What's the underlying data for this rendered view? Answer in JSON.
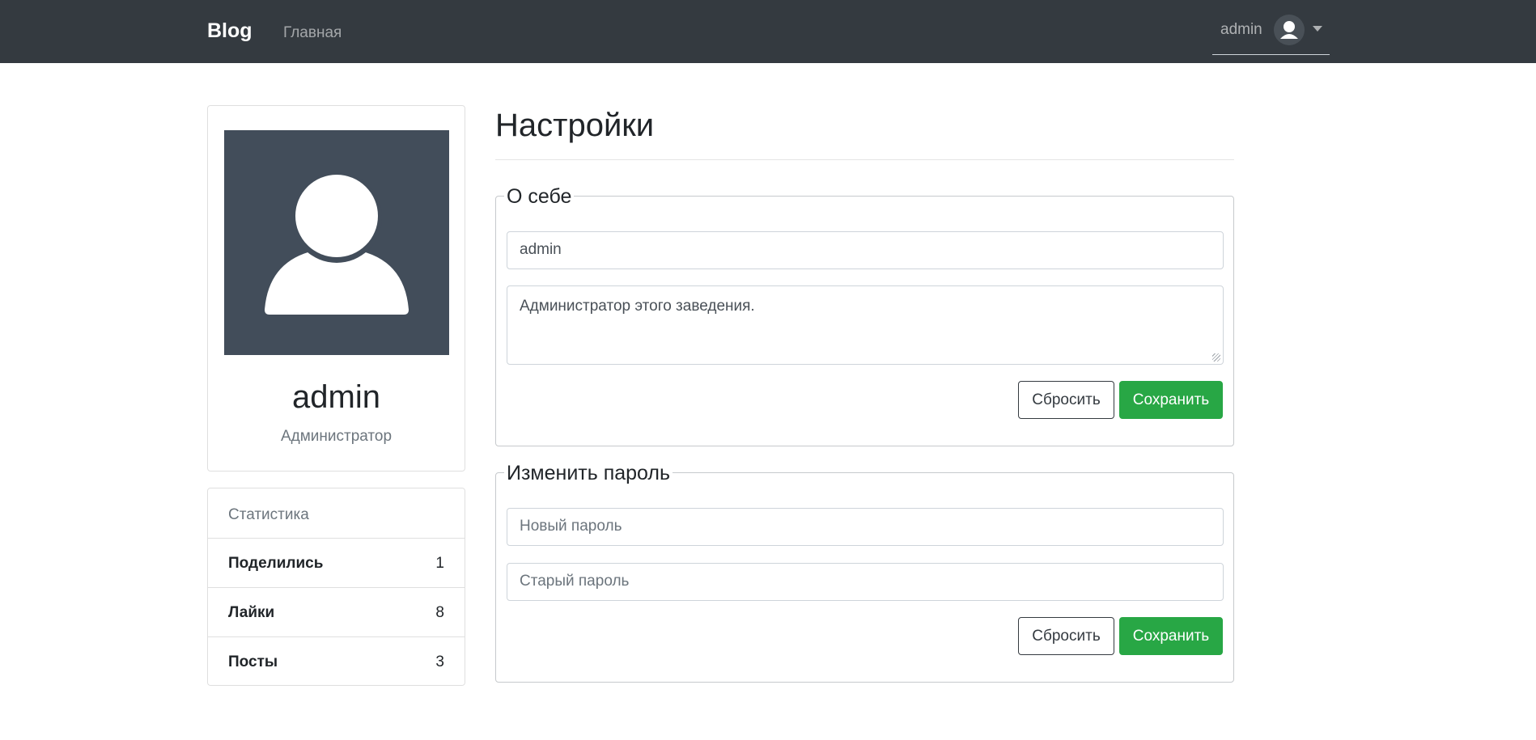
{
  "navbar": {
    "brand": "Blog",
    "home_link": "Главная",
    "user_name": "admin"
  },
  "profile": {
    "name": "admin",
    "role": "Администратор",
    "avatar_icon": "user-silhouette-icon"
  },
  "stats": {
    "heading": "Статистика",
    "rows": [
      {
        "label": "Поделились",
        "value": "1"
      },
      {
        "label": "Лайки",
        "value": "8"
      },
      {
        "label": "Посты",
        "value": "3"
      }
    ]
  },
  "settings": {
    "title": "Настройки",
    "about": {
      "legend": "О себе",
      "username_value": "admin",
      "bio_value": "Администратор этого заведения.",
      "reset_label": "Сбросить",
      "save_label": "Сохранить"
    },
    "password": {
      "legend": "Изменить пароль",
      "new_placeholder": "Новый пароль",
      "old_placeholder": "Старый пароль",
      "reset_label": "Сбросить",
      "save_label": "Сохранить"
    }
  },
  "colors": {
    "navbar": "#343a40",
    "success": "#28a745",
    "avatar_bg": "#424d5a"
  }
}
